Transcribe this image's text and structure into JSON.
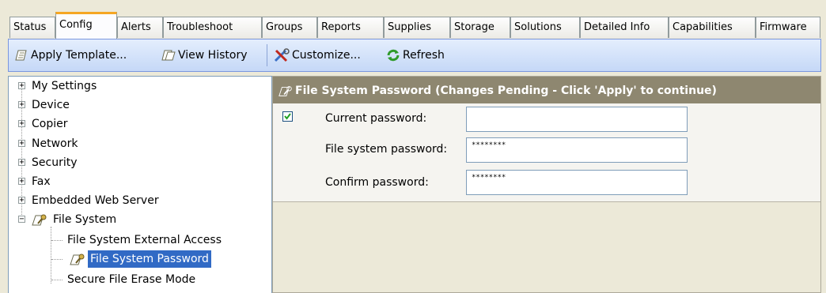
{
  "tabs": [
    {
      "label": "Status"
    },
    {
      "label": "Config",
      "active": true
    },
    {
      "label": "Alerts"
    },
    {
      "label": "Troubleshoot"
    },
    {
      "label": "Groups"
    },
    {
      "label": "Reports"
    },
    {
      "label": "Supplies"
    },
    {
      "label": "Storage"
    },
    {
      "label": "Solutions"
    },
    {
      "label": "Detailed Info"
    },
    {
      "label": "Capabilities"
    },
    {
      "label": "Firmware"
    }
  ],
  "toolbar": {
    "apply_template": "Apply Template...",
    "view_history": "View History",
    "customize": "Customize...",
    "refresh": "Refresh"
  },
  "tree": {
    "items": [
      {
        "label": "My Settings",
        "expander": "+"
      },
      {
        "label": "Device",
        "expander": "+"
      },
      {
        "label": "Copier",
        "expander": "+"
      },
      {
        "label": "Network",
        "expander": "+"
      },
      {
        "label": "Security",
        "expander": "+"
      },
      {
        "label": "Fax",
        "expander": "+"
      },
      {
        "label": "Embedded Web Server",
        "expander": "+"
      },
      {
        "label": "File System",
        "expander": "−"
      },
      {
        "label": "File System External Access"
      },
      {
        "label": "File System Password",
        "selected": true
      },
      {
        "label": "Secure File Erase Mode"
      }
    ]
  },
  "panel": {
    "title": "File System Password (Changes Pending - Click 'Apply' to continue)",
    "checkbox_checked": true,
    "fields": [
      {
        "label": "Current password:",
        "value": ""
      },
      {
        "label": "File system password:",
        "value": "********"
      },
      {
        "label": "Confirm password:",
        "value": "********"
      }
    ]
  },
  "colors": {
    "selection": "#316ac5",
    "panel_header": "#8e8770",
    "toolbar": "#c5d8f7",
    "active_tab_accent": "#f5a623"
  }
}
